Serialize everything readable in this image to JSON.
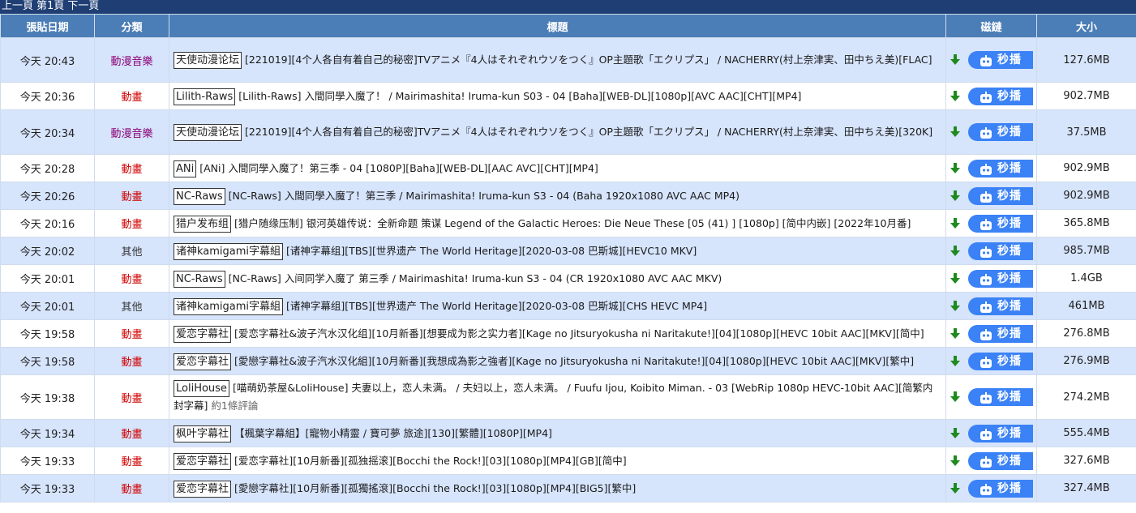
{
  "pager": {
    "prev": "上一頁",
    "current": "第1頁",
    "next": "下一頁"
  },
  "columns": {
    "date": "張貼日期",
    "category": "分類",
    "title": "標題",
    "magnet": "磁鏈",
    "size": "大小"
  },
  "play_label": "秒播",
  "icons": {
    "download": "download-arrow-icon",
    "play": "bot-icon"
  },
  "colors": {
    "header_bar": "#1f3f74",
    "column_header": "#4b7db6",
    "row_alt": "#d6e4fc",
    "anime": "#d10000",
    "music": "#8b0074",
    "play_button": "#3b82f6",
    "download_arrow": "#1e8a1e"
  },
  "rows": [
    {
      "date": "今天 20:43",
      "category": "動漫音樂",
      "cat_type": "music",
      "team": "天使动漫论坛",
      "title": "[221019][4个人各自有着自己的秘密]TVアニメ『4人はそれぞれウソをつく』OP主題歌「エクリプス」 / NACHERRY(村上奈津実、田中ちえ美)[FLAC]",
      "comment": "",
      "size": "127.6MB",
      "tall": true
    },
    {
      "date": "今天 20:36",
      "category": "動畫",
      "cat_type": "anime",
      "team": "Lilith-Raws",
      "title": "[Lilith-Raws] 入間同學入魔了！ / Mairimashita! Iruma-kun S03 - 04 [Baha][WEB-DL][1080p][AVC AAC][CHT][MP4]",
      "comment": "",
      "size": "902.7MB",
      "tall": false
    },
    {
      "date": "今天 20:34",
      "category": "動漫音樂",
      "cat_type": "music",
      "team": "天使动漫论坛",
      "title": "[221019][4个人各自有着自己的秘密]TVアニメ『4人はそれぞれウソをつく』OP主題歌「エクリプス」 / NACHERRY(村上奈津実、田中ちえ美)[320K]",
      "comment": "",
      "size": "37.5MB",
      "tall": true
    },
    {
      "date": "今天 20:28",
      "category": "動畫",
      "cat_type": "anime",
      "team": "ANi",
      "title": "[ANi] 入間同學入魔了！第三季 - 04 [1080P][Baha][WEB-DL][AAC AVC][CHT][MP4]",
      "comment": "",
      "size": "902.9MB",
      "tall": false
    },
    {
      "date": "今天 20:26",
      "category": "動畫",
      "cat_type": "anime",
      "team": "NC-Raws",
      "title": "[NC-Raws] 入間同學入魔了！第三季 / Mairimashita! Iruma-kun S3 - 04 (Baha 1920x1080 AVC AAC MP4)",
      "comment": "",
      "size": "902.9MB",
      "tall": false
    },
    {
      "date": "今天 20:16",
      "category": "動畫",
      "cat_type": "anime",
      "team": "猎户发布组",
      "title": "[猎户随缘压制] 银河英雄传说：全新命题 策谋 Legend of the Galactic Heroes: Die Neue These [05 (41) ] [1080p] [简中内嵌] [2022年10月番]",
      "comment": "",
      "size": "365.8MB",
      "tall": false
    },
    {
      "date": "今天 20:02",
      "category": "其他",
      "cat_type": "other",
      "team": "诸神kamigami字幕組",
      "title": "[诸神字幕组][TBS][世界遗产 The World Heritage][2020-03-08 巴斯城][HEVC10 MKV]",
      "comment": "",
      "size": "985.7MB",
      "tall": false
    },
    {
      "date": "今天 20:01",
      "category": "動畫",
      "cat_type": "anime",
      "team": "NC-Raws",
      "title": "[NC-Raws] 入间同学入魔了 第三季 / Mairimashita! Iruma-kun S3 - 04 (CR 1920x1080 AVC AAC MKV)",
      "comment": "",
      "size": "1.4GB",
      "tall": false
    },
    {
      "date": "今天 20:01",
      "category": "其他",
      "cat_type": "other",
      "team": "诸神kamigami字幕組",
      "title": "[诸神字幕组][TBS][世界遗产 The World Heritage][2020-03-08 巴斯城][CHS HEVC MP4]",
      "comment": "",
      "size": "461MB",
      "tall": false
    },
    {
      "date": "今天 19:58",
      "category": "動畫",
      "cat_type": "anime",
      "team": "爱恋字幕社",
      "title": "[爱恋字幕社&波子汽水汉化组][10月新番][想要成为影之实力者][Kage no Jitsuryokusha ni Naritakute!][04][1080p][HEVC 10bit AAC][MKV][简中]",
      "comment": "",
      "size": "276.8MB",
      "tall": false
    },
    {
      "date": "今天 19:58",
      "category": "動畫",
      "cat_type": "anime",
      "team": "爱恋字幕社",
      "title": "[愛戀字幕社&波子汽水汉化組][10月新番][我想成為影之強者][Kage no Jitsuryokusha ni Naritakute!][04][1080p][HEVC 10bit AAC][MKV][繁中]",
      "comment": "",
      "size": "276.9MB",
      "tall": false
    },
    {
      "date": "今天 19:38",
      "category": "動畫",
      "cat_type": "anime",
      "team": "LoliHouse",
      "title": "[喵萌奶茶屋&LoliHouse] 夫妻以上，恋人未满。 / 夫妇以上，恋人未满。 / Fuufu Ijou, Koibito Miman. - 03 [WebRip 1080p HEVC-10bit AAC][简繁内封字幕]",
      "comment": "約1條評論",
      "size": "274.2MB",
      "tall": true
    },
    {
      "date": "今天 19:34",
      "category": "動畫",
      "cat_type": "anime",
      "team": "枫叶字幕社",
      "title": "【楓葉字幕組】[寵物小精靈 / 寶可夢 旅途][130][繁體][1080P][MP4]",
      "comment": "",
      "size": "555.4MB",
      "tall": false
    },
    {
      "date": "今天 19:33",
      "category": "動畫",
      "cat_type": "anime",
      "team": "爱恋字幕社",
      "title": "[爱恋字幕社][10月新番][孤独摇滚][Bocchi the Rock!][03][1080p][MP4][GB][简中]",
      "comment": "",
      "size": "327.6MB",
      "tall": false
    },
    {
      "date": "今天 19:33",
      "category": "動畫",
      "cat_type": "anime",
      "team": "爱恋字幕社",
      "title": "[愛戀字幕社][10月新番][孤獨搖滾][Bocchi the Rock!][03][1080p][MP4][BIG5][繁中]",
      "comment": "",
      "size": "327.4MB",
      "tall": false
    }
  ]
}
